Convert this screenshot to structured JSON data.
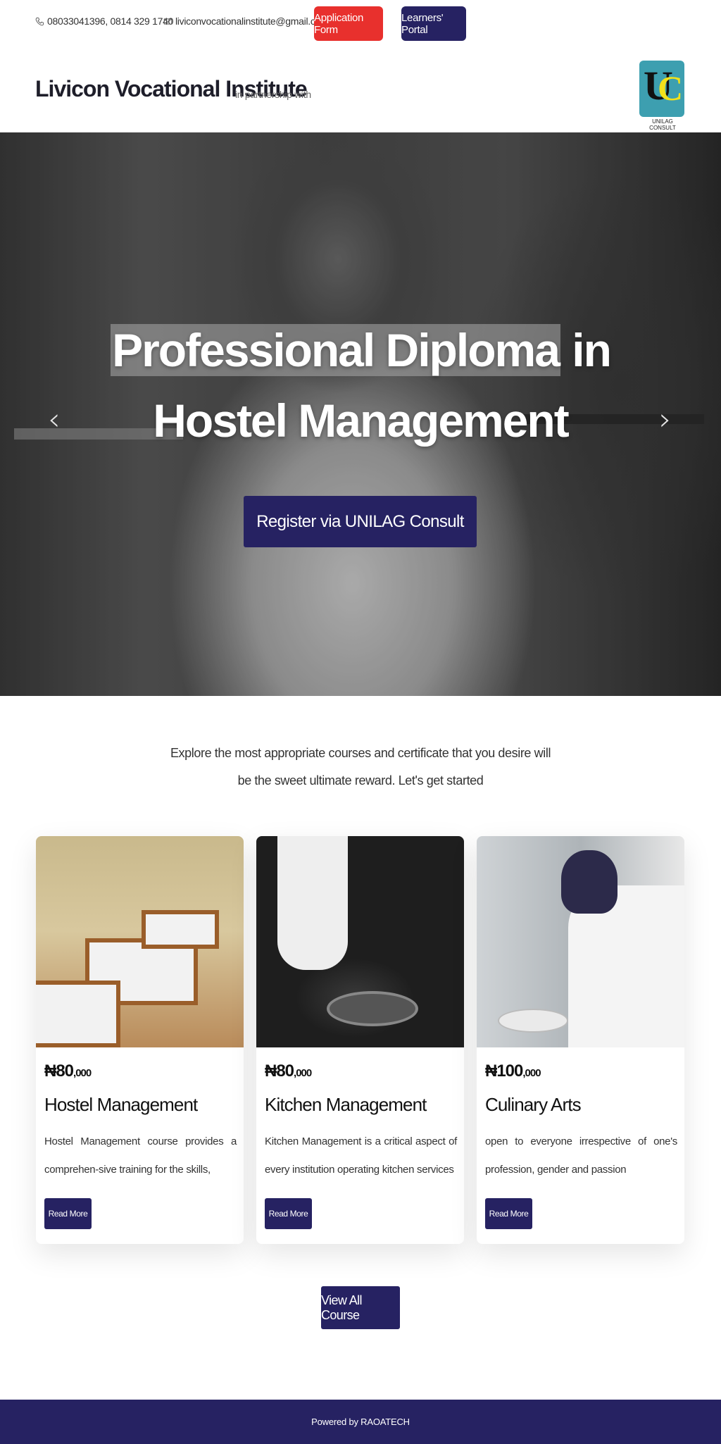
{
  "topbar": {
    "phone": "08033041396, 0814 329 1740",
    "email": "liviconvocationalinstitute@gmail.com",
    "application_form": "Application Form",
    "learners_portal": "Learners' Portal"
  },
  "header": {
    "brand": "Livicon Vocational Institute",
    "partner_text": "in partnership with",
    "logo_caption": "UNILAG CONSULT",
    "logo_letters": "UC"
  },
  "hero": {
    "title_highlight": "Professional Diploma",
    "title_rest": "in",
    "title_line2": "Hostel Management",
    "register_button": "Register via UNILAG Consult",
    "prev_icon": "‹",
    "next_icon": "›"
  },
  "intro": {
    "text": "Explore the most appropriate courses and certificate that you desire will be the sweet ultimate reward. Let's get started"
  },
  "courses": [
    {
      "price_main": "₦80",
      "price_tail": ",000",
      "title": "Hostel Management",
      "description": "Hostel Management course provides a comprehen-sive training for the skills,",
      "button": "Read More"
    },
    {
      "price_main": "₦80",
      "price_tail": ",000",
      "title": "Kitchen Management",
      "description": "Kitchen Management is a critical aspect of every institution operating kitchen services",
      "button": "Read More"
    },
    {
      "price_main": "₦100",
      "price_tail": ",000",
      "title": "Culinary Arts",
      "description": "open to everyone irrespective of one's profession, gender and passion",
      "button": "Read More"
    }
  ],
  "view_all": "View All Course",
  "footer": {
    "text": "Powered by RAOATECH"
  },
  "colors": {
    "primary": "#262262",
    "accent_red": "#e8302d"
  }
}
